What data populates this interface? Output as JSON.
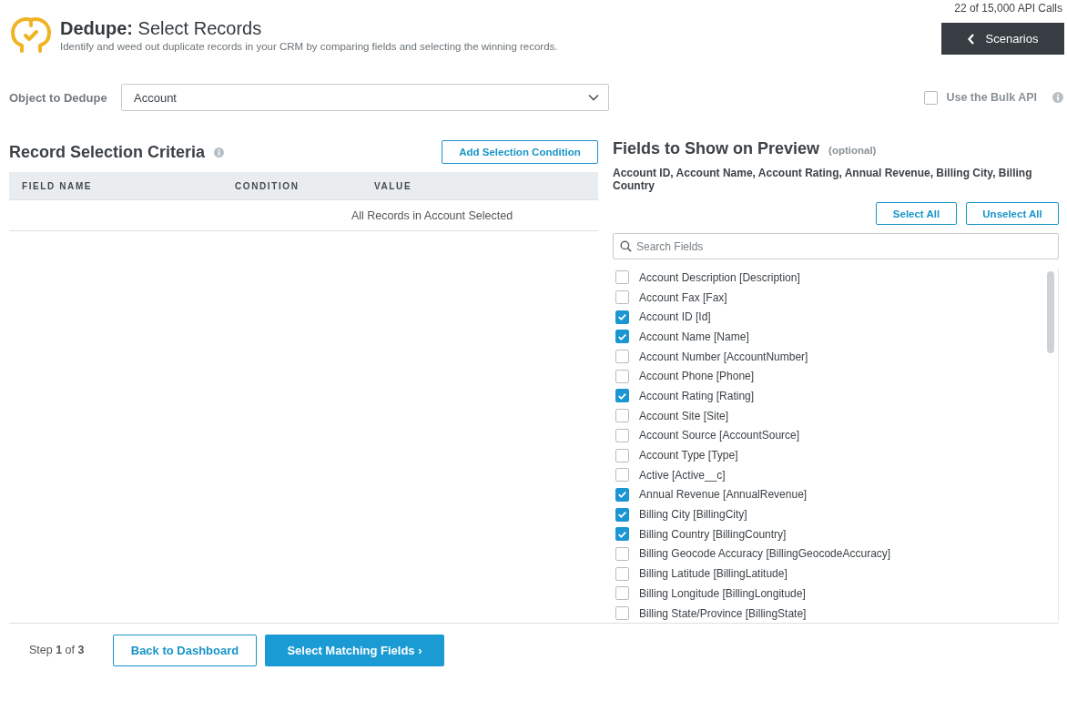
{
  "header": {
    "api_calls": "22 of 15,000 API Calls",
    "title": "**Dedupe:** Select Records",
    "subtitle": "Identify and weed out duplicate records in your CRM by comparing fields and selecting the winning records.",
    "scenarios_button": "Scenarios"
  },
  "object_select": {
    "label": "Object to Dedupe",
    "value": "Account"
  },
  "bulk_api": {
    "label": "Use the Bulk API",
    "checked": false
  },
  "criteria": {
    "title": "Record Selection Criteria",
    "add_button": "Add Selection Condition",
    "columns": [
      "FIELD NAME",
      "CONDITION",
      "VALUE"
    ],
    "empty_message": "All Records in Account Selected"
  },
  "preview": {
    "title": "Fields to Show on Preview",
    "hint": "(optional)",
    "summary": "Account ID, Account Name, Account Rating, Annual Revenue, Billing City, Billing Country",
    "select_all": "Select All",
    "unselect_all": "Unselect All",
    "search": {
      "placeholder": "Search Fields"
    },
    "fields": [
      {
        "label": "Account Description [Description]",
        "checked": false
      },
      {
        "label": "Account Fax [Fax]",
        "checked": false
      },
      {
        "label": "Account ID [Id]",
        "checked": true
      },
      {
        "label": "Account Name [Name]",
        "checked": true
      },
      {
        "label": "Account Number [AccountNumber]",
        "checked": false
      },
      {
        "label": "Account Phone [Phone]",
        "checked": false
      },
      {
        "label": "Account Rating [Rating]",
        "checked": true
      },
      {
        "label": "Account Site [Site]",
        "checked": false
      },
      {
        "label": "Account Source [AccountSource]",
        "checked": false
      },
      {
        "label": "Account Type [Type]",
        "checked": false
      },
      {
        "label": "Active [Active__c]",
        "checked": false
      },
      {
        "label": "Annual Revenue [AnnualRevenue]",
        "checked": true
      },
      {
        "label": "Billing City [BillingCity]",
        "checked": true
      },
      {
        "label": "Billing Country [BillingCountry]",
        "checked": true
      },
      {
        "label": "Billing Geocode Accuracy [BillingGeocodeAccuracy]",
        "checked": false
      },
      {
        "label": "Billing Latitude [BillingLatitude]",
        "checked": false
      },
      {
        "label": "Billing Longitude [BillingLongitude]",
        "checked": false
      },
      {
        "label": "Billing State/Province [BillingState]",
        "checked": false
      }
    ]
  },
  "footer": {
    "step": "Step **1** of **3**",
    "back_button": "Back to Dashboard",
    "next_button": "Select Matching Fields ›"
  }
}
